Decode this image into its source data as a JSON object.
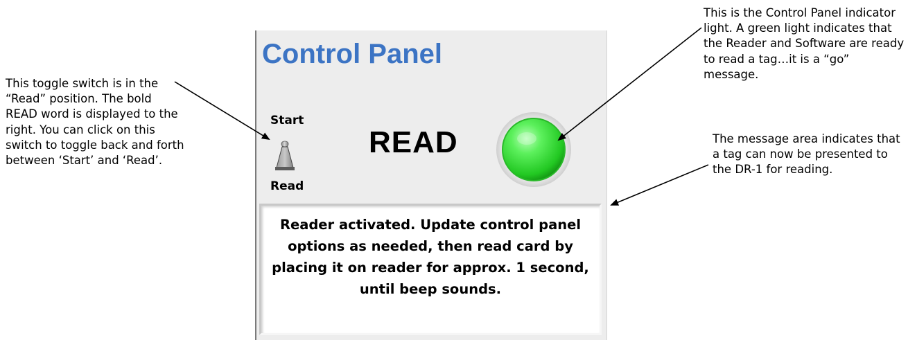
{
  "panel": {
    "title": "Control Panel",
    "toggle": {
      "top_label": "Start",
      "bottom_label": "Read",
      "position": "Read"
    },
    "status_word": "READ",
    "indicator": {
      "state": "green",
      "color": "#33dd33"
    },
    "message": "Reader activated.  Update control panel options as needed, then read card by placing it on reader for approx. 1 second, until beep sounds."
  },
  "callouts": {
    "toggle_note": "This toggle switch is in the “Read” position. The bold READ word is displayed to the right. You can click on this switch to toggle back and forth between ‘Start’ and ‘Read’.",
    "indicator_note": "This is the Control Panel indicator light.  A green light indicates that the Reader and Software are ready to read a tag…it is a “go” message.",
    "message_note": "The message area indicates that a tag can now be presented to the DR-1 for reading."
  },
  "colors": {
    "title": "#3c74c4",
    "panel_bg": "#ededed",
    "indicator_green": "#33dd33"
  }
}
